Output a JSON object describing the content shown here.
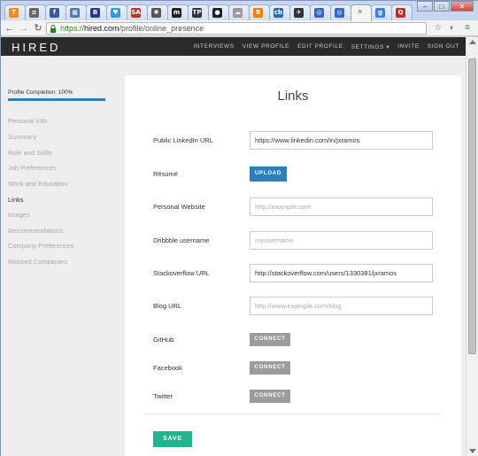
{
  "browser": {
    "tabs": [
      {
        "icon": "tab-favicon-orange-t",
        "glyph": "T",
        "color": "#f08a24"
      },
      {
        "icon": "tab-favicon-coffee",
        "glyph": "≡",
        "color": "#666666"
      },
      {
        "icon": "tab-favicon-f",
        "glyph": "f",
        "color": "#3b5998"
      },
      {
        "icon": "tab-favicon-grid",
        "glyph": "▦",
        "color": "#5577aa"
      },
      {
        "icon": "tab-favicon-b",
        "glyph": "B",
        "color": "#223a8a"
      },
      {
        "icon": "tab-favicon-heart",
        "glyph": "♥",
        "color": "#2d9cdb"
      },
      {
        "icon": "tab-favicon-sa",
        "glyph": "SA",
        "color": "#b33a2a"
      },
      {
        "icon": "tab-favicon-seal",
        "glyph": "✺",
        "color": "#555555"
      },
      {
        "icon": "tab-favicon-m",
        "glyph": "m",
        "color": "#222222"
      },
      {
        "icon": "tab-favicon-tp",
        "glyph": "TP",
        "color": "#333333"
      },
      {
        "icon": "tab-favicon-github",
        "glyph": "●",
        "color": "#222222"
      },
      {
        "icon": "tab-favicon-cloud",
        "glyph": "☁",
        "color": "#999999"
      },
      {
        "icon": "tab-favicon-blogger",
        "glyph": "B",
        "color": "#f57d00"
      },
      {
        "icon": "tab-favicon-cb",
        "glyph": "cb",
        "color": "#2b6cb0"
      },
      {
        "icon": "tab-favicon-bird",
        "glyph": "✈",
        "color": "#333333"
      },
      {
        "icon": "tab-favicon-ring",
        "glyph": "◎",
        "color": "#3366cc"
      },
      {
        "icon": "tab-favicon-ring2",
        "glyph": "◎",
        "color": "#3366cc"
      },
      {
        "icon": "tab-favicon-active",
        "glyph": "",
        "color": "#ffffff"
      },
      {
        "icon": "tab-favicon-g",
        "glyph": "g",
        "color": "#3f7ee8"
      },
      {
        "icon": "tab-favicon-q",
        "glyph": "Q",
        "color": "#c62828"
      }
    ],
    "active_tab_close": "×",
    "url_scheme": "https://",
    "url_host": "hired.com",
    "url_path": "/profile/online_presence"
  },
  "header": {
    "logo": "HIRED",
    "nav": [
      "INTERVIEWS",
      "VIEW PROFILE",
      "EDIT PROFILE",
      "SETTINGS ▾",
      "INVITE",
      "SIGN OUT"
    ]
  },
  "sidebar": {
    "progress_label": "Profile Completion: 100%",
    "progress": 1.0,
    "items": [
      "Personal Info",
      "Summary",
      "Role and Skills",
      "Job Preferences",
      "Work and Education",
      "Links",
      "Images",
      "Recommendations",
      "Company Preferences",
      "Blocked Companies"
    ],
    "active_index": 5
  },
  "main": {
    "title": "Links",
    "linkedin_label": "Public LinkedIn URL",
    "linkedin_value": "https://www.linkedin.com/in/jxramos",
    "resume_label": "Résumé",
    "upload_button": "UPLOAD",
    "website_label": "Personal Website",
    "website_placeholder": "http://example.com",
    "dribbble_label": "Dribbble username",
    "dribbble_placeholder": "myusername",
    "stackoverflow_label": "Stackoverflow URL",
    "stackoverflow_value": "http://stackoverflow.com/users/1330381/jxramos",
    "blog_label": "Blog URL",
    "blog_placeholder": "http://www.example.com/blog",
    "github_label": "GitHub",
    "facebook_label": "Facebook",
    "twitter_label": "Twitter",
    "connect_button": "CONNECT",
    "save_button": "SAVE"
  }
}
